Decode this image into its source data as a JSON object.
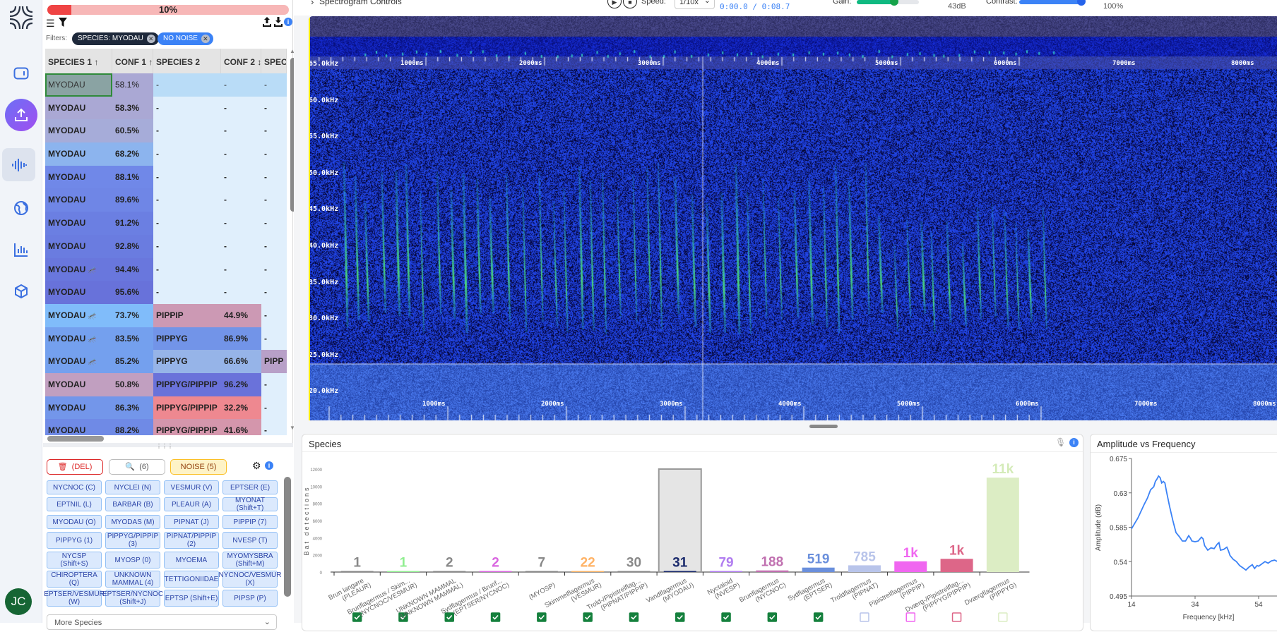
{
  "nav": {
    "items": [
      "logo",
      "window-icon",
      "upload-icon",
      "waveform-icon",
      "globe-icon",
      "bar-chart-icon",
      "cube-icon"
    ],
    "avatar": "JC",
    "accent": "#7c5cf0"
  },
  "progress": {
    "percent": 10,
    "label": "10%"
  },
  "filters": {
    "label": "Filters:",
    "chips": [
      "SPECIES: MYODAU",
      "NO NOISE"
    ]
  },
  "table": {
    "headers": [
      "SPECIES 1 ↑",
      "CONF 1 ↑",
      "SPECIES 2",
      "CONF 2 ↕",
      "SPEC"
    ],
    "rows": [
      {
        "s1": "MYODAU",
        "c1": "58.1%",
        "s2": "-",
        "c2": "-",
        "s3": "-",
        "bat": false,
        "col1": "#8aa3a3",
        "col2": "#aaa8d4",
        "col3": "#b9dcf7",
        "col5": "#b9dcf7",
        "selected": true
      },
      {
        "s1": "MYODAU",
        "c1": "58.3%",
        "s2": "-",
        "c2": "-",
        "s3": "-",
        "bat": false,
        "col1": "#aaa8d4"
      },
      {
        "s1": "MYODAU",
        "c1": "60.5%",
        "s2": "-",
        "c2": "-",
        "s3": "-",
        "bat": false,
        "col1": "#a6acd9"
      },
      {
        "s1": "MYODAU",
        "c1": "68.2%",
        "s2": "-",
        "c2": "-",
        "s3": "-",
        "bat": false,
        "col1": "#8cb4ee"
      },
      {
        "s1": "MYODAU",
        "c1": "88.1%",
        "s2": "-",
        "c2": "-",
        "s3": "-",
        "bat": false,
        "col1": "#7088e8"
      },
      {
        "s1": "MYODAU",
        "c1": "89.6%",
        "s2": "-",
        "c2": "-",
        "s3": "-",
        "bat": false,
        "col1": "#6f86e6"
      },
      {
        "s1": "MYODAU",
        "c1": "91.2%",
        "s2": "-",
        "c2": "-",
        "s3": "-",
        "bat": false,
        "col1": "#6b7fe2"
      },
      {
        "s1": "MYODAU",
        "c1": "92.8%",
        "s2": "-",
        "c2": "-",
        "s3": "-",
        "bat": false,
        "col1": "#6a7ce0"
      },
      {
        "s1": "MYODAU",
        "c1": "94.4%",
        "s2": "-",
        "c2": "-",
        "s3": "-",
        "bat": true,
        "col1": "#6977dd"
      },
      {
        "s1": "MYODAU",
        "c1": "95.6%",
        "s2": "-",
        "c2": "-",
        "s3": "-",
        "bat": false,
        "col1": "#6872da"
      },
      {
        "s1": "MYODAU",
        "c1": "73.7%",
        "s2": "PIPPIP",
        "c2": "44.9%",
        "s3": "-",
        "bat": true,
        "col1": "#80bcfa",
        "col3": "#cc99b4"
      },
      {
        "s1": "MYODAU",
        "c1": "83.5%",
        "s2": "PIPPYG",
        "c2": "86.9%",
        "s3": "-",
        "bat": true,
        "col1": "#74a0ee",
        "col3": "#7294e8"
      },
      {
        "s1": "MYODAU",
        "c1": "85.2%",
        "s2": "PIPPYG",
        "c2": "66.6%",
        "s3": "PIPP",
        "bat": true,
        "col1": "#74a0ee",
        "col3": "#96b4e8",
        "col5": "#b8a0c8"
      },
      {
        "s1": "MYODAU",
        "c1": "50.8%",
        "s2": "PIPPYG/PIPPIP",
        "c2": "96.2%",
        "s3": "-",
        "bat": false,
        "col1": "#c19fc0",
        "col3": "#6a72da"
      },
      {
        "s1": "MYODAU",
        "c1": "86.3%",
        "s2": "PIPPYG/PIPPIP",
        "c2": "32.2%",
        "s3": "-",
        "bat": false,
        "col1": "#7396ea",
        "col3": "#ee8890"
      },
      {
        "s1": "MYODAU",
        "c1": "88.2%",
        "s2": "PIPPYG/PIPPIP",
        "c2": "41.6%",
        "s3": "-",
        "bat": false,
        "col1": "#6f8ae6",
        "col3": "#d496ac"
      }
    ]
  },
  "actions": {
    "delete": "(DEL)",
    "search": "(6)",
    "noise": "NOISE (5)"
  },
  "species_buttons": [
    "NYCNOC (C)",
    "NYCLEI (N)",
    "VESMUR (V)",
    "EPTSER (E)",
    "EPTNIL (L)",
    "BARBAR (B)",
    "PLEAUR (A)",
    "MYONAT (Shift+T)",
    "MYODAU (O)",
    "MYODAS (M)",
    "PIPNAT (J)",
    "PIPPIP (7)",
    "PIPPYG (1)",
    "PIPPYG/PIPPIP (3)",
    "PIPNAT/PIPPIP (2)",
    "NVESP (T)",
    "NYCSP (Shift+S)",
    "MYOSP (0)",
    "MYOEMA",
    "MYOMYSBRA (Shift+M)",
    "CHIROPTERA (Q)",
    "UNKNOWN MAMMAL (4)",
    "TETTIGONIIDAE",
    "NYCNOC/VESMUR (X)",
    "EPTSER/VESMUR (W)",
    "EPTSER/NYCNOC (Shift+J)",
    "EPTSP (Shift+E)",
    "PIPSP (P)"
  ],
  "more_species": "More Species",
  "controls": {
    "title": "Spectrogram Controls",
    "speed_label": "Speed:",
    "speed": "1/10x",
    "time": "0:00.0 / 0:08.7",
    "gain_label": "Gain:",
    "gain": "43dB",
    "gain_level": 0.6,
    "contrast_label": "Contrast:",
    "contrast": "100%",
    "contrast_level": 1.0
  },
  "spectrogram": {
    "freq_labels": [
      "65.0kHz",
      "60.0kHz",
      "55.0kHz",
      "50.0kHz",
      "45.0kHz",
      "40.0kHz",
      "35.0kHz",
      "30.0kHz",
      "25.0kHz",
      "20.0kHz"
    ],
    "time_labels": [
      "1000ms",
      "2000ms",
      "3000ms",
      "4000ms",
      "5000ms",
      "6000ms",
      "7000ms",
      "8000ms"
    ]
  },
  "species_panel_title": "Species",
  "amplitude_panel_title": "Amplitude vs Frequency",
  "chart_data": [
    {
      "type": "bar",
      "ylabel": "Bat detections",
      "ylim": [
        0,
        12000
      ],
      "yticks": [
        0,
        2000,
        4000,
        6000,
        8000,
        10000,
        12000
      ],
      "categories": [
        "Brun langøre (PLEAUR)",
        "Brunflagermus / Skim... (NYCNOC/VESMUR)",
        "UNKNOWN MAMMAL (UNKNOWN MAMMAL)",
        "Sydflagermus / Brunf... (EPTSER/NYCNOC)",
        "(MYOSP)",
        "Skimmelflagermus (VESMUR)",
        "Trold-/Pipistrelflag... (PIPNAT/PIPPIP)",
        "Vandflagermus (MYODAU)",
        "Nyctaloid (NVESP)",
        "Brunflagermus (NYCNOC)",
        "Sydflagermus (EPTSER)",
        "Troldflagermus (PIPNAT)",
        "Pipistrelflagermus (PIPPIP)",
        "Dværg-/Pipistrelflag... (PIPPYG/PIPPIP)",
        "Dværgflagermus (PIPPYG)"
      ],
      "values": [
        1,
        1,
        2,
        2,
        7,
        22,
        30,
        31,
        79,
        188,
        519,
        785,
        1250,
        1540,
        11000
      ],
      "value_labels": [
        "1",
        "1",
        "2",
        "2",
        "7",
        "22",
        "30",
        "31",
        "79",
        "188",
        "519",
        "785",
        "1k",
        "1k",
        "11k"
      ],
      "colors": [
        "#888888",
        "#90ee90",
        "#888888",
        "#d966e0",
        "#888888",
        "#ffb366",
        "#888888",
        "#1a2a6c",
        "#b07cf0",
        "#c070b0",
        "#6a8fdc",
        "#b8c4ea",
        "#f066f0",
        "#dd6688",
        "#dcedc4"
      ],
      "checked": [
        true,
        true,
        true,
        true,
        true,
        true,
        true,
        true,
        true,
        true,
        true,
        false,
        false,
        false,
        false
      ],
      "selected": "Vandflagermus (MYODAU)"
    },
    {
      "type": "line",
      "xlabel": "Frequency [kHz]",
      "ylabel": "Amplitude (dB)",
      "xlim": [
        14,
        60
      ],
      "ylim": [
        0.495,
        0.675
      ],
      "xticks": [
        14,
        34,
        54
      ],
      "yticks": [
        0.495,
        0.54,
        0.585,
        0.63,
        0.675
      ],
      "x": [
        14,
        15,
        16,
        17,
        18,
        19,
        20,
        21,
        21.5,
        22,
        22.5,
        23,
        23.5,
        24,
        24.5,
        25,
        26,
        27,
        28,
        29,
        30,
        31,
        32,
        32.5,
        33,
        34,
        35,
        36,
        36.5,
        37,
        38,
        39,
        40,
        41,
        41.5,
        42,
        43,
        44,
        44.5,
        45,
        46,
        47,
        48,
        49,
        50,
        51,
        52,
        52.7,
        53.5,
        54,
        55,
        56,
        57,
        58,
        59,
        60
      ],
      "y": [
        0.583,
        0.59,
        0.597,
        0.606,
        0.615,
        0.623,
        0.634,
        0.638,
        0.645,
        0.648,
        0.652,
        0.65,
        0.643,
        0.645,
        0.643,
        0.632,
        0.612,
        0.594,
        0.578,
        0.573,
        0.567,
        0.567,
        0.574,
        0.571,
        0.567,
        0.566,
        0.567,
        0.572,
        0.57,
        0.561,
        0.555,
        0.558,
        0.557,
        0.563,
        0.565,
        0.555,
        0.556,
        0.559,
        0.554,
        0.548,
        0.543,
        0.54,
        0.535,
        0.532,
        0.529,
        0.533,
        0.536,
        0.531,
        0.535,
        0.534,
        0.537,
        0.54,
        0.538,
        0.541,
        0.542,
        0.54
      ],
      "color": "#3b82f6"
    }
  ]
}
